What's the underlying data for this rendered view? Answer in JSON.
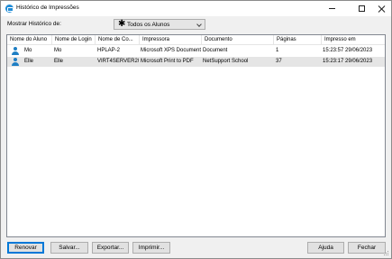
{
  "window": {
    "title": "Histórico de Impressões"
  },
  "filter": {
    "label": "Mostrar Histórico de:",
    "selected": "Todos os Alunos"
  },
  "table": {
    "columns": [
      "Nome do Aluno",
      "Nome de Login",
      "Nome de Co...",
      "Impressora",
      "Documento",
      "Páginas",
      "Impresso em"
    ],
    "rows": [
      {
        "student": "Mo",
        "login": "Mo",
        "computer": "HPLAP-2",
        "printer": "Microsoft XPS Document Writer",
        "document": "Document",
        "pages": "1",
        "printed_at": "15:23:57 29/06/2023"
      },
      {
        "student": "Elle",
        "login": "Elle",
        "computer": "VIRT4SERVER20",
        "printer": "Microsoft Print to PDF",
        "document": "NetSupport School",
        "pages": "37",
        "printed_at": "15:23:17 29/06/2023"
      }
    ]
  },
  "buttons": {
    "refresh": "Renovar",
    "save": "Salvar...",
    "export": "Exportar...",
    "print": "Imprimir...",
    "help": "Ajuda",
    "close": "Fechar"
  },
  "colors": {
    "accent": "#0078d7",
    "user_icon": "#1f7fc4",
    "selected_row": "#e5e5e5"
  }
}
